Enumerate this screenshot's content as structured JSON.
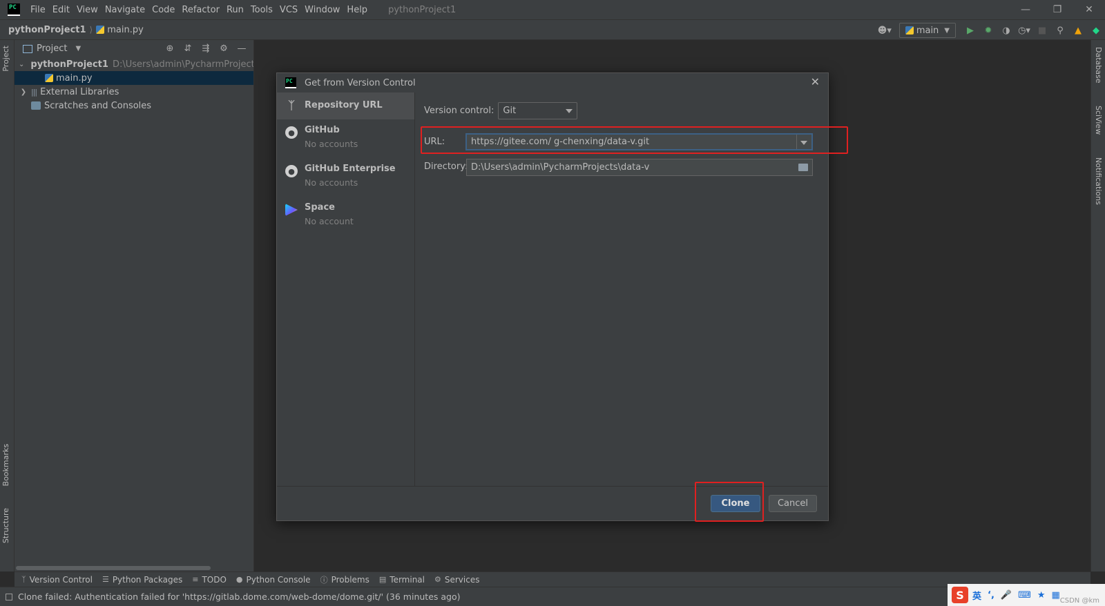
{
  "app": {
    "window_title": "pythonProject1",
    "logo_text": "PC",
    "menu": [
      "File",
      "Edit",
      "View",
      "Navigate",
      "Code",
      "Refactor",
      "Run",
      "Tools",
      "VCS",
      "Window",
      "Help"
    ]
  },
  "navbar": {
    "project": "pythonProject1",
    "file": "main.py",
    "run_config": "main"
  },
  "left_strip": {
    "tabs": [
      "Project",
      "Bookmarks",
      "Structure"
    ]
  },
  "right_strip": {
    "tabs": [
      "Database",
      "SciView",
      "Notifications"
    ]
  },
  "project_panel": {
    "title": "Project",
    "tree": [
      {
        "label": "pythonProject1",
        "path": "D:\\Users\\admin\\PycharmProjects\\py"
      },
      {
        "label": "main.py"
      },
      {
        "label": "External Libraries"
      },
      {
        "label": "Scratches and Consoles"
      }
    ]
  },
  "dialog": {
    "title": "Get from Version Control",
    "sidebar": [
      {
        "label": "Repository URL",
        "sub": ""
      },
      {
        "label": "GitHub",
        "sub": "No accounts"
      },
      {
        "label": "GitHub Enterprise",
        "sub": "No accounts"
      },
      {
        "label": "Space",
        "sub": "No account"
      }
    ],
    "version_control_label": "Version control:",
    "version_control_value": "Git",
    "url_label": "URL:",
    "url_value": "https://gitee.com/ g-chenxing/data-v.git",
    "directory_label": "Directory:",
    "directory_value": "D:\\Users\\admin\\PycharmProjects\\data-v",
    "clone_button": "Clone",
    "cancel_button": "Cancel"
  },
  "bottom_tools": [
    "Version Control",
    "Python Packages",
    "TODO",
    "Python Console",
    "Problems",
    "Terminal",
    "Services"
  ],
  "status": {
    "message": "Clone failed: Authentication failed for 'https://gitlab.dome.com/web-dome/dome.git/' (36 minutes ago)"
  },
  "ime": {
    "lang": "英",
    "watermark": "CSDN @km"
  },
  "colors": {
    "highlight_box": "#e02020",
    "primary_button": "#365880",
    "selection": "#0d293e"
  }
}
